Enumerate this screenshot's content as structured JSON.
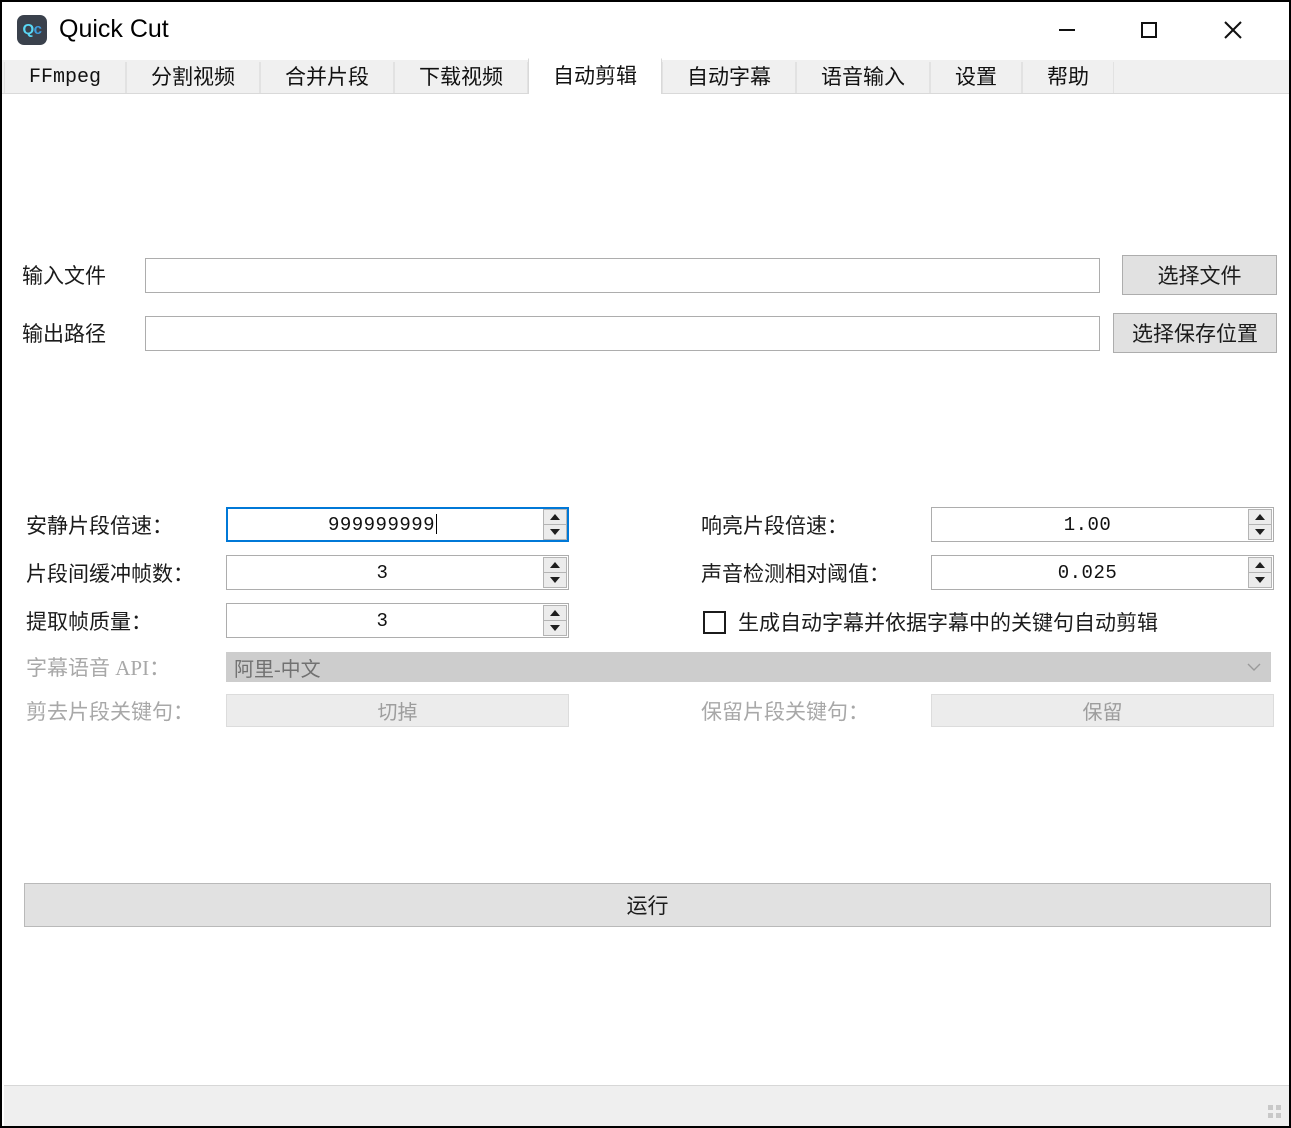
{
  "window": {
    "title": "Quick Cut",
    "icon_text_q": "Qc",
    "minimize_label": "—",
    "maximize_label": "▢",
    "close_label": "✕"
  },
  "tabs": [
    {
      "label": "FFmpeg",
      "selected": false,
      "mono": true
    },
    {
      "label": "分割视频",
      "selected": false,
      "mono": false
    },
    {
      "label": "合并片段",
      "selected": false,
      "mono": false
    },
    {
      "label": "下载视频",
      "selected": false,
      "mono": false
    },
    {
      "label": "自动剪辑",
      "selected": true,
      "mono": false
    },
    {
      "label": "自动字幕",
      "selected": false,
      "mono": false
    },
    {
      "label": "语音输入",
      "selected": false,
      "mono": false
    },
    {
      "label": "设置",
      "selected": false,
      "mono": false
    },
    {
      "label": "帮助",
      "selected": false,
      "mono": false
    }
  ],
  "form": {
    "input_file": {
      "label": "输入文件",
      "value": "",
      "placeholder": "",
      "button_label": "选择文件"
    },
    "output_path": {
      "label": "输出路径",
      "value": "",
      "placeholder": "",
      "button_label": "选择保存位置"
    },
    "silent_speed": {
      "label": "安静片段倍速：",
      "value": "999999999",
      "focused": true
    },
    "loud_speed": {
      "label": "响亮片段倍速：",
      "value": "1.00",
      "focused": false
    },
    "buffer_frames": {
      "label": "片段间缓冲帧数：",
      "value": "3",
      "focused": false
    },
    "sound_threshold": {
      "label": "声音检测相对阈值：",
      "value": "0.025",
      "focused": false
    },
    "frame_quality": {
      "label": "提取帧质量：",
      "value": "3",
      "focused": false
    },
    "auto_subtitle_checkbox": {
      "label": "生成自动字幕并依据字幕中的关键句自动剪辑",
      "checked": false
    },
    "subtitle_api": {
      "label": "字幕语音 API：",
      "value": "阿里-中文",
      "disabled": true
    },
    "cut_keywords": {
      "label": "剪去片段关键句：",
      "value": "切掉",
      "disabled": true
    },
    "keep_keywords": {
      "label": "保留片段关键句：",
      "value": "保留",
      "disabled": true
    },
    "run_button": {
      "label": "运行"
    }
  },
  "colors": {
    "accent_focus": "#0078d7",
    "button_face": "#e1e1e1",
    "tab_bar": "#f0f0f0",
    "disabled_fill": "#cdcdcd",
    "status_bar": "#efefef"
  }
}
